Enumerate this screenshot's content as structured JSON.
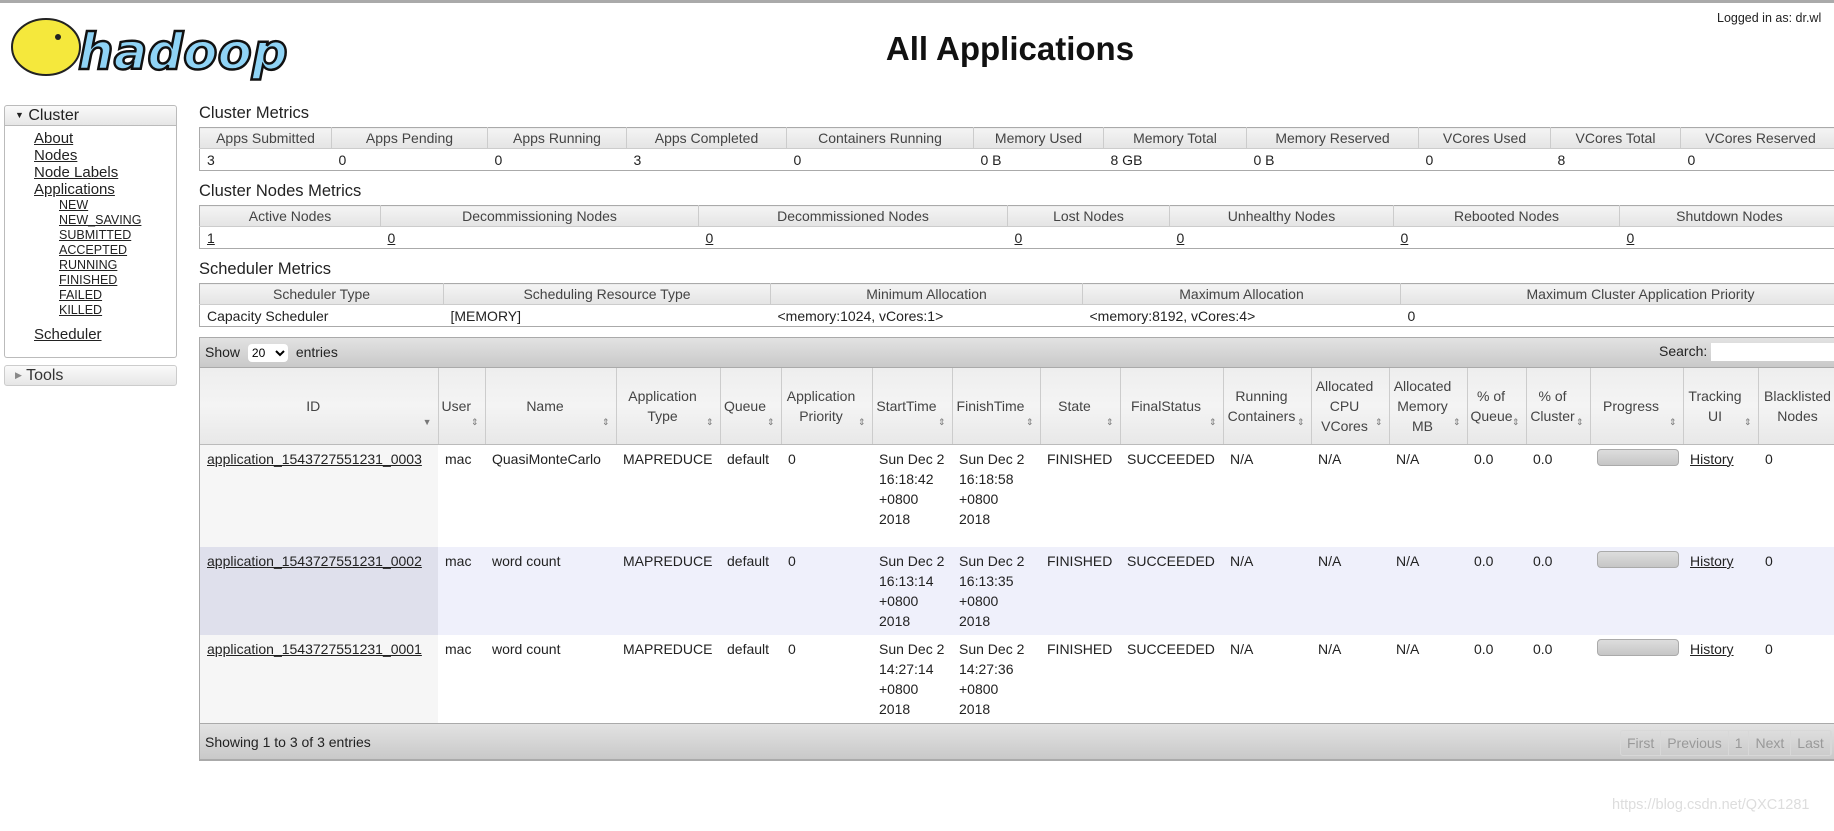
{
  "header": {
    "title": "All Applications",
    "logged_in": "Logged in as: dr.wl",
    "logo_text": "hadoop"
  },
  "sidebar": {
    "cluster_label": "Cluster",
    "links": [
      "About",
      "Nodes",
      "Node Labels",
      "Applications"
    ],
    "app_states": [
      "NEW",
      "NEW_SAVING",
      "SUBMITTED",
      "ACCEPTED",
      "RUNNING",
      "FINISHED",
      "FAILED",
      "KILLED"
    ],
    "scheduler": "Scheduler",
    "tools_label": "Tools"
  },
  "cluster_metrics": {
    "title": "Cluster Metrics",
    "headers": [
      "Apps Submitted",
      "Apps Pending",
      "Apps Running",
      "Apps Completed",
      "Containers Running",
      "Memory Used",
      "Memory Total",
      "Memory Reserved",
      "VCores Used",
      "VCores Total",
      "VCores Reserved"
    ],
    "values": [
      "3",
      "0",
      "0",
      "3",
      "0",
      "0 B",
      "8 GB",
      "0 B",
      "0",
      "8",
      "0"
    ]
  },
  "node_metrics": {
    "title": "Cluster Nodes Metrics",
    "headers": [
      "Active Nodes",
      "Decommissioning Nodes",
      "Decommissioned Nodes",
      "Lost Nodes",
      "Unhealthy Nodes",
      "Rebooted Nodes",
      "Shutdown Nodes"
    ],
    "values": [
      "1",
      "0",
      "0",
      "0",
      "0",
      "0",
      "0"
    ]
  },
  "scheduler_metrics": {
    "title": "Scheduler Metrics",
    "headers": [
      "Scheduler Type",
      "Scheduling Resource Type",
      "Minimum Allocation",
      "Maximum Allocation",
      "Maximum Cluster Application Priority"
    ],
    "values": [
      "Capacity Scheduler",
      "[MEMORY]",
      "<memory:1024, vCores:1>",
      "<memory:8192, vCores:4>",
      "0"
    ]
  },
  "apps_table": {
    "show_label": "Show",
    "entries_label": "entries",
    "page_size": "20",
    "search_label": "Search:",
    "search_value": "",
    "columns": [
      "ID",
      "User",
      "Name",
      "Application Type",
      "Queue",
      "Application Priority",
      "StartTime",
      "FinishTime",
      "State",
      "FinalStatus",
      "Running Containers",
      "Allocated CPU VCores",
      "Allocated Memory MB",
      "% of Queue",
      "% of Cluster",
      "Progress",
      "Tracking UI",
      "Blacklisted Nodes"
    ],
    "rows": [
      {
        "id": "application_1543727551231_0003",
        "user": "mac",
        "name": "QuasiMonteCarlo",
        "type": "MAPREDUCE",
        "queue": "default",
        "priority": "0",
        "start": "Sun Dec 2 16:18:42 +0800 2018",
        "finish": "Sun Dec 2 16:18:58 +0800 2018",
        "state": "FINISHED",
        "final": "SUCCEEDED",
        "containers": "N/A",
        "vcores": "N/A",
        "memory": "N/A",
        "pct_queue": "0.0",
        "pct_cluster": "0.0",
        "progress": 100,
        "tracking": "History",
        "blacklisted": "0"
      },
      {
        "id": "application_1543727551231_0002",
        "user": "mac",
        "name": "word count",
        "type": "MAPREDUCE",
        "queue": "default",
        "priority": "0",
        "start": "Sun Dec 2 16:13:14 +0800 2018",
        "finish": "Sun Dec 2 16:13:35 +0800 2018",
        "state": "FINISHED",
        "final": "SUCCEEDED",
        "containers": "N/A",
        "vcores": "N/A",
        "memory": "N/A",
        "pct_queue": "0.0",
        "pct_cluster": "0.0",
        "progress": 100,
        "tracking": "History",
        "blacklisted": "0"
      },
      {
        "id": "application_1543727551231_0001",
        "user": "mac",
        "name": "word count",
        "type": "MAPREDUCE",
        "queue": "default",
        "priority": "0",
        "start": "Sun Dec 2 14:27:14 +0800 2018",
        "finish": "Sun Dec 2 14:27:36 +0800 2018",
        "state": "FINISHED",
        "final": "SUCCEEDED",
        "containers": "N/A",
        "vcores": "N/A",
        "memory": "N/A",
        "pct_queue": "0.0",
        "pct_cluster": "0.0",
        "progress": 100,
        "tracking": "History",
        "blacklisted": "0"
      }
    ],
    "footer_info": "Showing 1 to 3 of 3 entries",
    "pager": [
      "First",
      "Previous",
      "1",
      "Next",
      "Last"
    ]
  },
  "watermark": "https://blog.csdn.net/QXC1281"
}
